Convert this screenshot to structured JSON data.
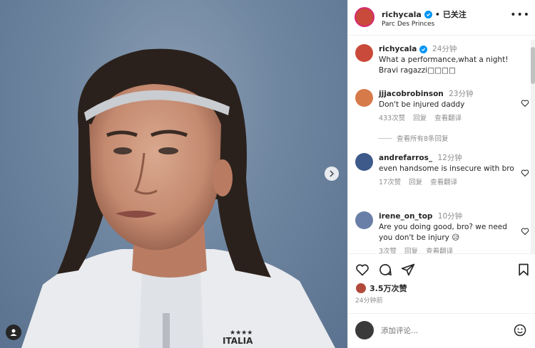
{
  "post": {
    "username": "richycala",
    "follow_label": "已关注",
    "dot": "•",
    "location": "Parc Des Princes",
    "more_label": "•••"
  },
  "caption": {
    "username": "richycala",
    "time": "24分钟",
    "text": "What a performance,what a night! Bravi ragazzi□□□□"
  },
  "comments": [
    {
      "username": "jjjacobrobinson",
      "time": "23分钟",
      "text": "Don't be injured daddy",
      "likes": "433次赞",
      "reply": "回复",
      "translate": "查看翻译"
    },
    {
      "username": "andrefarros_",
      "time": "12分钟",
      "text": "even handsome is insecure with bro",
      "likes": "17次赞",
      "reply": "回复",
      "translate": "查看翻译"
    },
    {
      "username": "irene_on_top",
      "time": "10分钟",
      "text": "Are you doing good, bro? we need you don't be injury 😥",
      "likes": "3次赞",
      "reply": "回复",
      "translate": "查看翻译"
    }
  ],
  "view_replies": "查看所有8条回复",
  "likes_total": "3.5万次赞",
  "post_time": "24分钟前",
  "add_comment_placeholder": "添加评论...",
  "colors": {
    "verified": "#0095f6",
    "story_ring": "#d62976",
    "muted": "#8e8e8e"
  },
  "photo": {
    "jersey_text": "ITALIA",
    "stars": "★★★★"
  }
}
